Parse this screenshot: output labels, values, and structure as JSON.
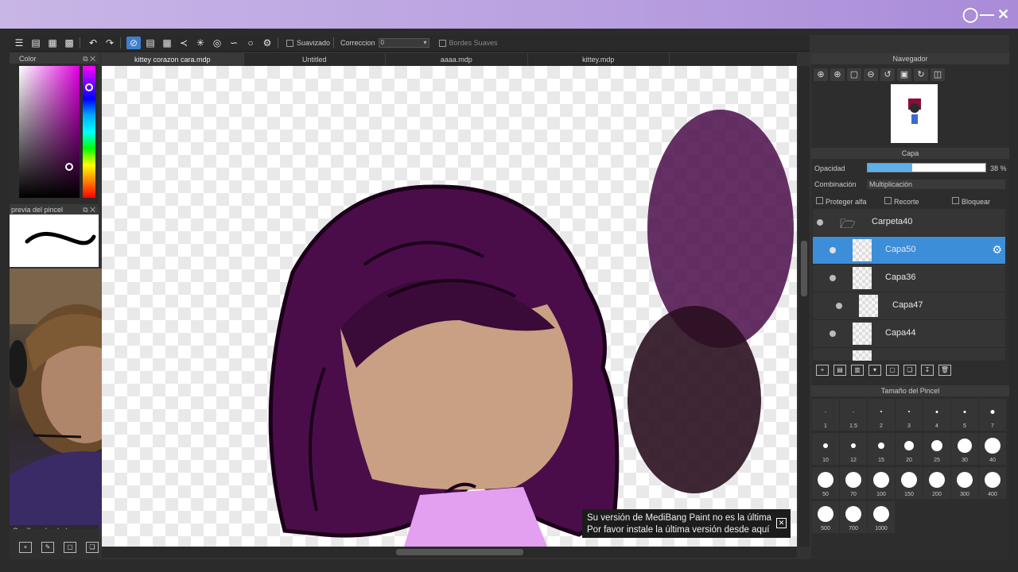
{
  "toolbar": {
    "smooth_label": "Suavizado",
    "correction_label": "Correccion",
    "correction_value": "0",
    "soft_edges_label": "Bordes Suaves"
  },
  "panels": {
    "color_title": "Color",
    "brush_preview_title": "previa del pincel",
    "brush_name": "Cepillo redondo (a",
    "navigator_title": "Navegador",
    "layer_title": "Capa",
    "brush_size_title": "Tamaño del Pincel"
  },
  "tabs": [
    {
      "label": "kittey corazon cara.mdp"
    },
    {
      "label": "Untitled"
    },
    {
      "label": "aaaa.mdp"
    },
    {
      "label": "kittey.mdp"
    }
  ],
  "colors": {
    "accent": "#3c8ed9",
    "hair": "#4a0d4a",
    "skin": "#c9a084",
    "shirt": "#e39ff0"
  },
  "layer_panel": {
    "opacity_label": "Opacidad",
    "opacity_value": "38 %",
    "opacity_fraction": 0.38,
    "blend_label": "Combinación",
    "blend_value": "Multiplicación",
    "protect_alpha": "Proteger alfa",
    "clip": "Recorte",
    "lock": "Bloquear",
    "layers": [
      {
        "name": "Carpeta40"
      },
      {
        "name": "Capa50"
      },
      {
        "name": "Capa36"
      },
      {
        "name": "Capa47"
      },
      {
        "name": "Capa44"
      }
    ]
  },
  "brush_sizes": [
    [
      "1",
      "1.5",
      "2",
      "3",
      "4",
      "5",
      "7"
    ],
    [
      "10",
      "12",
      "15",
      "20",
      "25",
      "30",
      "40"
    ],
    [
      "50",
      "70",
      "100",
      "150",
      "200",
      "300",
      "400"
    ],
    [
      "500",
      "700",
      "1000"
    ]
  ],
  "notice": {
    "line1": "Su versión de MediBang Paint no es la última",
    "line2": "Por favor instale la última versión desde aquí"
  }
}
